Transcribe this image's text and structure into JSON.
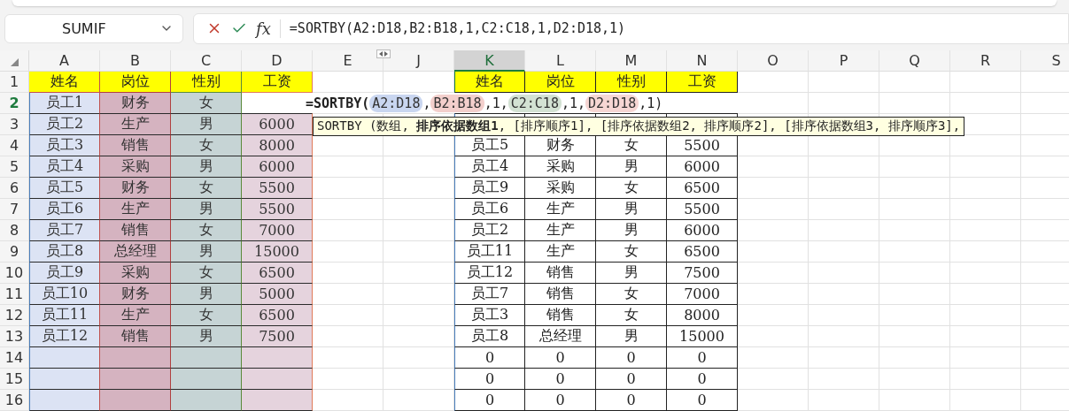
{
  "name_box": {
    "value": "SUMIF"
  },
  "formula_bar": {
    "fx_label": "fx",
    "formula": "=SORTBY(A2:D18,B2:B18,1,C2:C18,1,D2:D18,1)"
  },
  "columns": [
    {
      "label": "A",
      "selected": false
    },
    {
      "label": "B",
      "selected": false
    },
    {
      "label": "C",
      "selected": false
    },
    {
      "label": "D",
      "selected": false
    },
    {
      "label": "E",
      "selected": false
    },
    {
      "label": "J",
      "selected": false
    },
    {
      "label": "K",
      "selected": true
    },
    {
      "label": "L",
      "selected": false
    },
    {
      "label": "M",
      "selected": false
    },
    {
      "label": "N",
      "selected": false
    },
    {
      "label": "O",
      "selected": false
    },
    {
      "label": "P",
      "selected": false
    },
    {
      "label": "Q",
      "selected": false
    },
    {
      "label": "R",
      "selected": false
    },
    {
      "label": "S",
      "selected": false
    }
  ],
  "rows": [
    {
      "label": "1",
      "selected": false
    },
    {
      "label": "2",
      "selected": true
    },
    {
      "label": "3",
      "selected": false
    },
    {
      "label": "4",
      "selected": false
    },
    {
      "label": "5",
      "selected": false
    },
    {
      "label": "6",
      "selected": false
    },
    {
      "label": "7",
      "selected": false
    },
    {
      "label": "8",
      "selected": false
    },
    {
      "label": "9",
      "selected": false
    },
    {
      "label": "10",
      "selected": false
    },
    {
      "label": "11",
      "selected": false
    },
    {
      "label": "12",
      "selected": false
    },
    {
      "label": "13",
      "selected": false
    },
    {
      "label": "14",
      "selected": false
    },
    {
      "label": "15",
      "selected": false
    },
    {
      "label": "16",
      "selected": false
    }
  ],
  "source_table": {
    "header": [
      "姓名",
      "岗位",
      "性别",
      "工资"
    ],
    "rows": [
      [
        "员工1",
        "财务",
        "女"
      ],
      [
        "员工2",
        "生产",
        "男",
        "6000"
      ],
      [
        "员工3",
        "销售",
        "女",
        "8000"
      ],
      [
        "员工4",
        "采购",
        "男",
        "6000"
      ],
      [
        "员工5",
        "财务",
        "女",
        "5500"
      ],
      [
        "员工6",
        "生产",
        "男",
        "5500"
      ],
      [
        "员工7",
        "销售",
        "女",
        "7000"
      ],
      [
        "员工8",
        "总经理",
        "男",
        "15000"
      ],
      [
        "员工9",
        "采购",
        "女",
        "6500"
      ],
      [
        "员工10",
        "财务",
        "男",
        "5000"
      ],
      [
        "员工11",
        "生产",
        "女",
        "6500"
      ],
      [
        "员工12",
        "销售",
        "男",
        "7500"
      ]
    ]
  },
  "cell_editor": {
    "parts": [
      {
        "kind": "text",
        "text": "=SORTBY("
      },
      {
        "kind": "ref",
        "text": "A2:D18",
        "color": "#c9d6f0"
      },
      {
        "kind": "text",
        "text": ","
      },
      {
        "kind": "ref",
        "text": "B2:B18",
        "color": "#f3cfcc"
      },
      {
        "kind": "text",
        "text": ",1,"
      },
      {
        "kind": "ref",
        "text": "C2:C18",
        "color": "#d3e2d3"
      },
      {
        "kind": "text",
        "text": ",1,"
      },
      {
        "kind": "ref",
        "text": "D2:D18",
        "color": "#f6d6d3"
      },
      {
        "kind": "text",
        "text": ",1)"
      }
    ]
  },
  "tooltip": {
    "text": "SORTBY (数组, **排序依据数组1**, [排序顺序1], [排序依据数组2, 排序顺序2], [排序依据数组3, 排序顺序3],"
  },
  "result_table": {
    "header": [
      "姓名",
      "岗位",
      "性别",
      "工资"
    ],
    "rows": [
      [
        "员工5",
        "财务",
        "女",
        "5500"
      ],
      [
        "员工4",
        "采购",
        "男",
        "6000"
      ],
      [
        "员工9",
        "采购",
        "女",
        "6500"
      ],
      [
        "员工6",
        "生产",
        "男",
        "5500"
      ],
      [
        "员工2",
        "生产",
        "男",
        "6000"
      ],
      [
        "员工11",
        "生产",
        "女",
        "6500"
      ],
      [
        "员工12",
        "销售",
        "男",
        "7500"
      ],
      [
        "员工7",
        "销售",
        "女",
        "7000"
      ],
      [
        "员工3",
        "销售",
        "女",
        "8000"
      ],
      [
        "员工8",
        "总经理",
        "男",
        "15000"
      ],
      [
        "0",
        "0",
        "0",
        "0"
      ],
      [
        "0",
        "0",
        "0",
        "0"
      ],
      [
        "0",
        "0",
        "0",
        "0"
      ]
    ]
  }
}
